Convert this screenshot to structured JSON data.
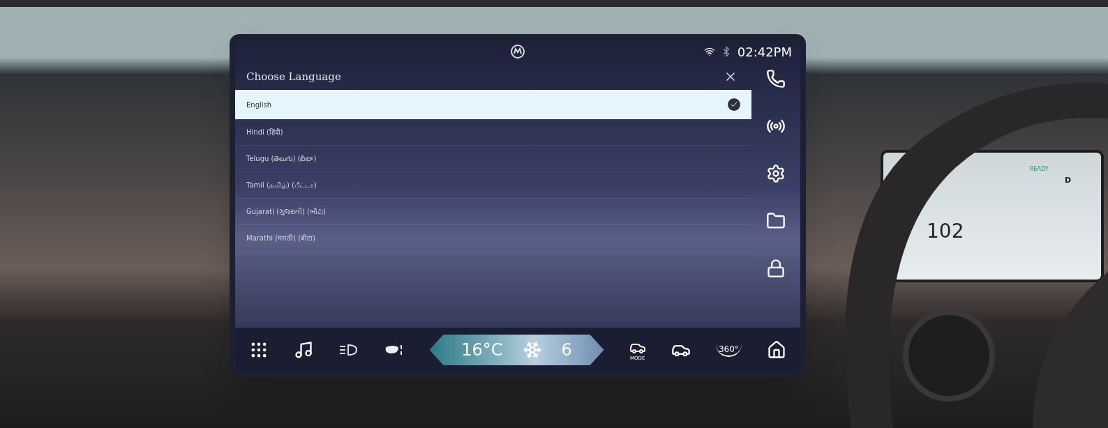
{
  "status_bar": {
    "time": "02:42PM"
  },
  "dialog": {
    "title": "Choose Language",
    "languages": [
      {
        "label": "English",
        "selected": true
      },
      {
        "label": "Hindi (हिंदी)",
        "selected": false
      },
      {
        "label": "Telugu (తెలుగు) (బీటా)",
        "selected": false
      },
      {
        "label": "Tamil (தமிழ்) (பீட்டா)",
        "selected": false
      },
      {
        "label": "Gujarati (ગુજરાતી) (બીટા)",
        "selected": false
      },
      {
        "label": "Marathi (मराठी) (बीटा)",
        "selected": false
      }
    ]
  },
  "climate": {
    "temperature": "16°C",
    "fan_speed": "6"
  },
  "bottom_bar": {
    "mode_label": "MODE",
    "view_label": "360°"
  },
  "cluster": {
    "status": "READY",
    "gear": "D",
    "speed": "102"
  }
}
